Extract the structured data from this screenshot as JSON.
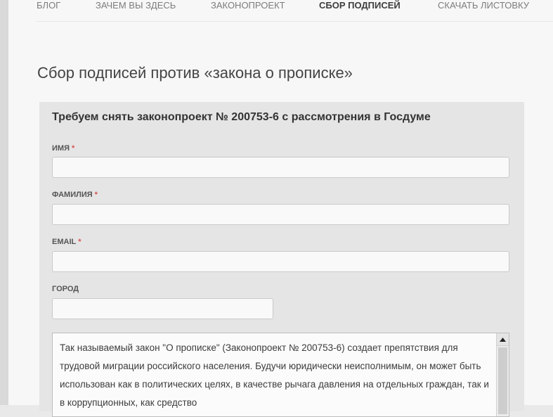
{
  "nav": {
    "items": [
      {
        "label": "БЛОГ"
      },
      {
        "label": "ЗАЧЕМ ВЫ ЗДЕСЬ"
      },
      {
        "label": "ЗАКОНОПРОЕКТ"
      },
      {
        "label": "СБОР ПОДПИСЕЙ",
        "active": true
      },
      {
        "label": "СКАЧАТЬ ЛИСТОВКУ"
      }
    ]
  },
  "page": {
    "title": "Сбор подписей против «закона о прописке»"
  },
  "form": {
    "heading": "Требуем снять законопроект № 200753-6 с рассмотрения в Госдуме",
    "required_mark": "*",
    "fields": [
      {
        "label": "ИМЯ",
        "value": "",
        "required": true
      },
      {
        "label": "ФАМИЛИЯ",
        "value": "",
        "required": true
      },
      {
        "label": "EMAIL",
        "value": "",
        "required": true
      },
      {
        "label": "ГОРОД",
        "value": "",
        "required": false
      }
    ],
    "message_text": "Так называемый закон \"О прописке\" (Законопроект № 200753-6) создает препятствия для трудовой миграции российского населения. Будучи юридически неисполнимым, он может быть использован как в политических целях, в качестве рычага давления на отдельных граждан, так и в коррупционных, как средство"
  },
  "icons": {
    "scroll_up": "scroll-up-arrow-icon"
  },
  "colors": {
    "background": "#f7f7f7",
    "form_box": "#e5e5e5",
    "required": "#d9534f",
    "active_nav": "#3d3d3d"
  }
}
